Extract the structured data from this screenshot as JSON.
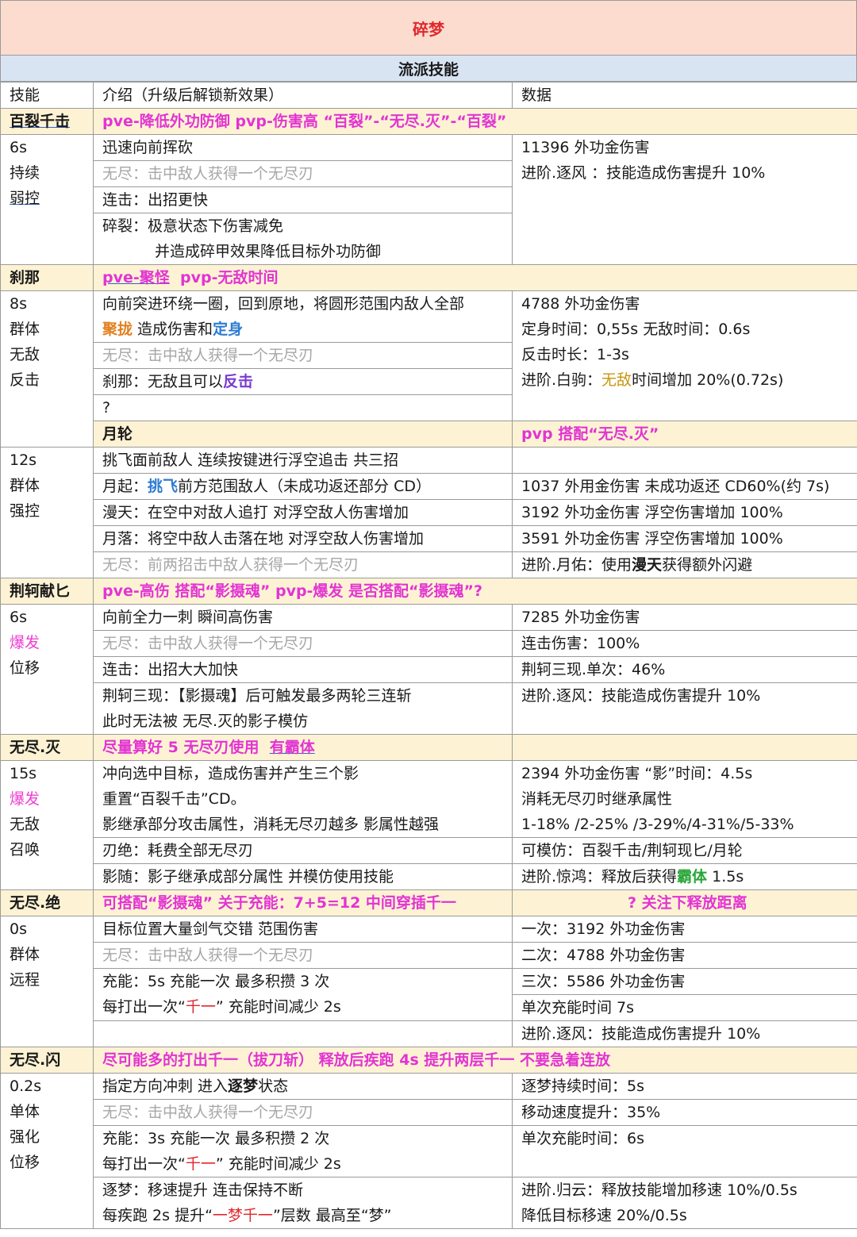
{
  "title": "碎梦",
  "subtitle": "流派技能",
  "columns": [
    "技能",
    "介绍（升级后解锁新效果）",
    "数据"
  ],
  "s1": {
    "name": "百裂千击",
    "note": "pve-降低外功防御  pvp-伤害高 “百裂”-“无尽.灭”-“百裂”",
    "tags": [
      "6s",
      "持续",
      "弱控"
    ],
    "rows": [
      "迅速向前挥砍",
      "无尽：击中敌人获得一个无尽刃",
      "连击：出招更快",
      "碎裂：极意状态下伤害减免",
      "并造成碎甲效果降低目标外功防御"
    ],
    "data": [
      "11396 外功金伤害",
      "进阶.逐风 ：技能造成伤害提升 10%"
    ]
  },
  "s2": {
    "name": "刹那",
    "note_a": "pve-聚怪",
    "note_b": "pvp-无敌时间",
    "tags": [
      "8s",
      "群体",
      "无敌",
      "反击"
    ],
    "r1": "向前突进环绕一圈，回到原地，将圆形范围内敌人全部",
    "r2a": "聚拢",
    "r2b": " 造成伤害和",
    "r2c": "定身",
    "r3": "无尽：击中敌人获得一个无尽刃",
    "r4a": "刹那：无敌且可以",
    "r4b": "反击",
    "r5": "?",
    "data": [
      "4788 外功金伤害",
      "定身时间：0,55s  无敌时间：0.6s",
      "反击时长：1-3s"
    ],
    "d4a": "进阶.白驹：",
    "d4b": "无敌",
    "d4c": "时间增加  20%(0.72s)"
  },
  "s3": {
    "name": "月轮",
    "note": "pvp 搭配“无尽.灭”",
    "tags": [
      "12s",
      "群体",
      "强控"
    ],
    "r1": "挑飞面前敌人  连续按键进行浮空追击  共三招",
    "r2a": "月起：",
    "r2b": "挑飞",
    "r2c": "前方范围敌人（未成功返还部分 CD）",
    "r3": "漫天：在空中对敌人追打  对浮空敌人伤害增加",
    "r4": "月落：将空中敌人击落在地  对浮空敌人伤害增加",
    "r5": "无尽：前两招击中敌人获得一个无尽刃",
    "d2": "1037 外用金伤害  未成功返还 CD60%(约 7s)",
    "d3": "3192 外功金伤害    浮空伤害增加 100%",
    "d4": "3591 外功金伤害    浮空伤害增加 100%",
    "d5a": "进阶.月佑：使用",
    "d5b": "漫天",
    "d5c": "获得额外闪避"
  },
  "s4": {
    "name": "荆轲献匕",
    "note": "pve-高伤  搭配“影摄魂”  pvp-爆发  是否搭配“影摄魂”?",
    "tags": [
      "6s",
      "爆发",
      "位移"
    ],
    "r1": "向前全力一刺  瞬间高伤害",
    "r2": "无尽：击中敌人获得一个无尽刃",
    "r3": "连击：出招大大加快",
    "r4": "荆轲三现：【影摄魂】后可触发最多两轮三连斩",
    "r5": "此时无法被  无尽.灭的影子模仿",
    "data": [
      "7285 外功金伤害",
      "连击伤害：100%",
      "荆轲三现.单次：46%",
      "进阶.逐风：技能造成伤害提升 10%"
    ]
  },
  "s5": {
    "name": "无尽.灭",
    "note_a": "尽量算好 5 无尽刃使用 ",
    "note_b": "有霸体",
    "tags": [
      "15s",
      "爆发",
      "无敌",
      "召唤"
    ],
    "r1": "冲向选中目标，造成伤害并产生三个影",
    "r2": "重置“百裂千击”CD。",
    "r3": "影继承部分攻击属性，消耗无尽刃越多  影属性越强",
    "r4": "刃绝：耗费全部无尽刃",
    "r5": "影随：影子继承成部分属性  并模仿使用技能",
    "d1": "2394 外功金伤害        “影”时间：4.5s",
    "d2": "消耗无尽刃时继承属性",
    "d3": "1-18% /2-25% /3-29%/4-31%/5-33%",
    "d4": "可模仿：百裂千击/荆轲现匕/月轮",
    "d5a": "进阶.惊鸿：释放后获得",
    "d5b": "霸体",
    "d5c": " 1.5s"
  },
  "s6": {
    "name": "无尽.绝",
    "note": "可搭配“影摄魂”  关于充能：7+5=12  中间穿插千一",
    "note2": "? 关注下释放距离",
    "tags": [
      "0s",
      "群体",
      "远程"
    ],
    "r1": "目标位置大量剑气交错  范围伤害",
    "r2": "无尽：击中敌人获得一个无尽刃",
    "r3": "充能：5s 充能一次  最多积攒 3 次",
    "r4a": "每打出一次“",
    "r4b": "千一",
    "r4c": "” 充能时间减少 2s",
    "d1": "一次：3192 外功金伤害",
    "d2": "二次：4788 外功金伤害",
    "d3": "三次：5586 外功金伤害",
    "d4": "单次充能时间 7s",
    "d5": "进阶.逐风：技能造成伤害提升 10%"
  },
  "s7": {
    "name": "无尽.闪",
    "note": "尽可能多的打出千一（拔刀斩）  释放后疾跑 4s 提升两层千一  不要急着连放",
    "tags": [
      "0.2s",
      "单体",
      "强化",
      "位移"
    ],
    "r1a": "指定方向冲刺  进入",
    "r1b": "逐梦",
    "r1c": "状态",
    "r2": "无尽：击中敌人获得一个无尽刃",
    "r3": "充能：3s 充能一次  最多积攒 2 次",
    "r4a": "每打出一次“",
    "r4b": "千一",
    "r4c": "” 充能时间减少 2s",
    "r5": "逐梦：移速提升  连击保持不断",
    "r6a": "每疾跑 2s 提升“",
    "r6b": "一梦千一",
    "r6c": "”层数  最高至“梦”",
    "d1": "逐梦持续时间：5s",
    "d2": "移动速度提升：35%",
    "d3": "单次充能时间：6s",
    "d5": "进阶.归云：释放技能增加移速  10%/0.5s",
    "d6": "降低目标移速  20%/0.5s"
  }
}
